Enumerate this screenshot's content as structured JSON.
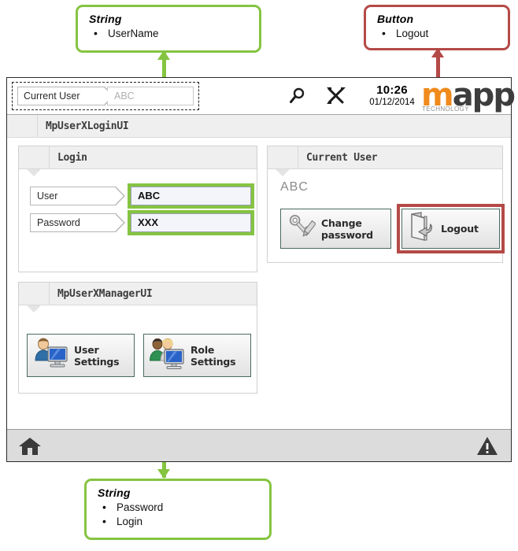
{
  "annotations": {
    "top_left": {
      "title": "String",
      "items": [
        "UserName"
      ],
      "color": "#85c441"
    },
    "top_right": {
      "title": "Button",
      "items": [
        "Logout"
      ],
      "color": "#b44a47"
    },
    "bottom": {
      "title": "String",
      "items": [
        "Password",
        "Login"
      ],
      "color": "#85c441"
    }
  },
  "topbar": {
    "current_user_label": "Current User",
    "current_user_value": "ABC",
    "search_icon": "magnifier-icon",
    "tools_icon": "tools-icon",
    "time": "10:26",
    "date": "01/12/2014",
    "logo": {
      "m": "m",
      "app": "app",
      "tagline": "TECHNOLOGY"
    }
  },
  "page_header": {
    "title": "MpUserXLoginUI"
  },
  "login_panel": {
    "title": "Login",
    "fields": [
      {
        "label": "User",
        "value": "ABC"
      },
      {
        "label": "Password",
        "value": "XXX"
      }
    ]
  },
  "current_user_panel": {
    "title": "Current User",
    "user_name": "ABC",
    "buttons": [
      {
        "label": "Change\npassword",
        "line1": "Change",
        "line2": "password",
        "icon": "key-pencil-icon"
      },
      {
        "label": "Logout",
        "line1": "Logout",
        "line2": "",
        "icon": "exit-door-icon"
      }
    ]
  },
  "manager_panel": {
    "title": "MpUserXManagerUI",
    "buttons": [
      {
        "line1": "User",
        "line2": "Settings",
        "icon": "user-monitor-icon"
      },
      {
        "line1": "Role Settings",
        "line2": "",
        "icon": "users-monitor-icon"
      }
    ]
  },
  "statusbar": {
    "home_icon": "home-icon",
    "warning_icon": "warning-triangle-icon"
  },
  "colors": {
    "annotation_green": "#85c441",
    "annotation_red": "#b44a47",
    "field_marker_orange": "#f08a1c",
    "logo_orange": "#f08a1c",
    "button_border": "#4a6b60"
  }
}
